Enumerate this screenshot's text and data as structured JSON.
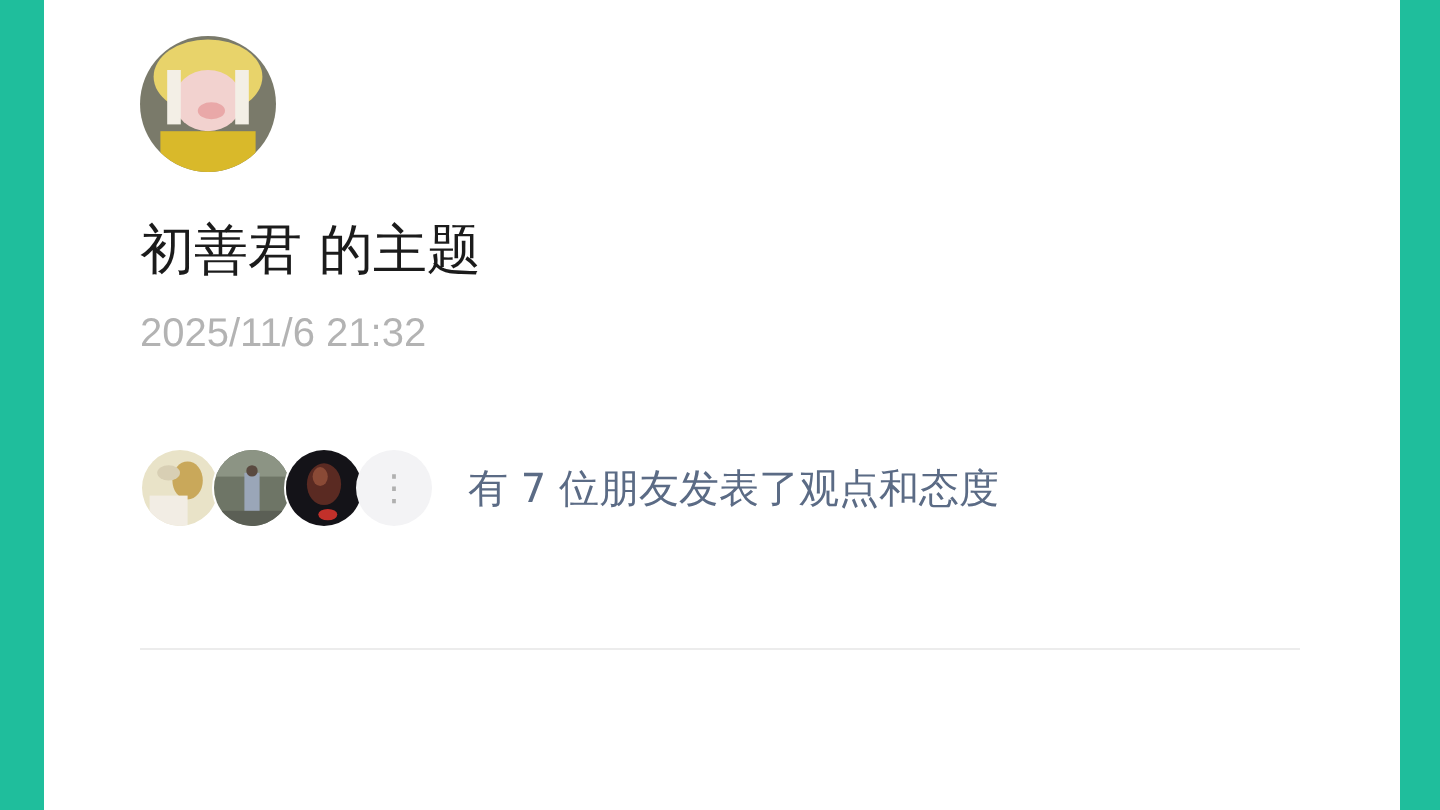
{
  "post": {
    "title": "初善君 的主题",
    "timestamp": "2025/11/6 21:32"
  },
  "reactions": {
    "more": "⋮",
    "summary": "有 7 位朋友发表了观点和态度"
  }
}
